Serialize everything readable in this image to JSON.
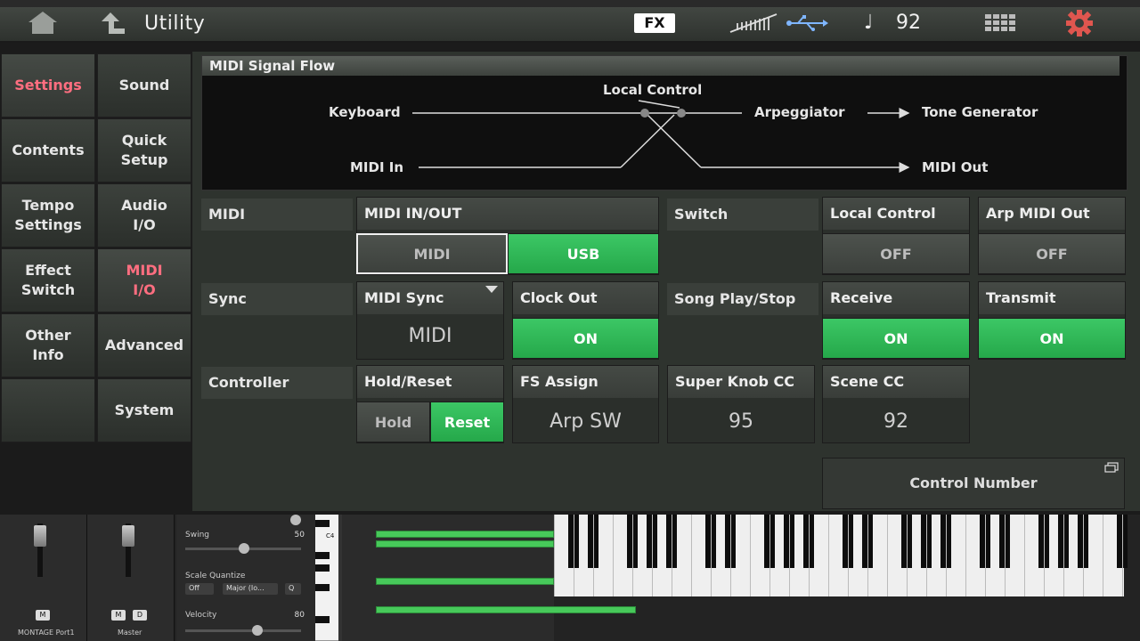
{
  "header": {
    "title": "Utility",
    "fx_label": "FX",
    "note_symbol": "♩",
    "tempo": "92"
  },
  "nav": {
    "left": [
      {
        "label": "Settings",
        "active": true
      },
      {
        "label": "Contents",
        "active": false
      },
      {
        "label": "Tempo\nSettings",
        "active": false
      },
      {
        "label": "Effect\nSwitch",
        "active": false
      },
      {
        "label": "Other\nInfo",
        "active": false
      }
    ],
    "right": [
      {
        "label": "Sound",
        "active": false
      },
      {
        "label": "Quick\nSetup",
        "active": false
      },
      {
        "label": "Audio\nI/O",
        "active": false
      },
      {
        "label": "MIDI\nI/O",
        "active": true
      },
      {
        "label": "Advanced",
        "active": false
      },
      {
        "label": "System",
        "active": false
      }
    ]
  },
  "flow": {
    "title": "MIDI Signal Flow",
    "keyboard": "Keyboard",
    "local_control": "Local Control",
    "arpeggiator": "Arpeggiator",
    "tone_generator": "Tone Generator",
    "midi_in": "MIDI In",
    "midi_out": "MIDI Out"
  },
  "rows": {
    "midi": "MIDI",
    "sync": "Sync",
    "controller": "Controller"
  },
  "midi_inout": {
    "label": "MIDI IN/OUT",
    "option_midi": "MIDI",
    "option_usb": "USB",
    "selected": "USB"
  },
  "switch": {
    "label": "Switch"
  },
  "local_control": {
    "label": "Local Control",
    "value": "OFF"
  },
  "arp_midi_out": {
    "label": "Arp MIDI Out",
    "value": "OFF"
  },
  "midi_sync": {
    "label": "MIDI Sync",
    "value": "MIDI"
  },
  "clock_out": {
    "label": "Clock Out",
    "value": "ON"
  },
  "song_play_stop": {
    "label": "Song Play/Stop"
  },
  "receive": {
    "label": "Receive",
    "value": "ON"
  },
  "transmit": {
    "label": "Transmit",
    "value": "ON"
  },
  "hold_reset": {
    "label": "Hold/Reset",
    "option_hold": "Hold",
    "option_reset": "Reset",
    "selected": "Reset"
  },
  "fs_assign": {
    "label": "FS Assign",
    "value": "Arp SW"
  },
  "super_knob_cc": {
    "label": "Super Knob CC",
    "value": "95"
  },
  "scene_cc": {
    "label": "Scene CC",
    "value": "92"
  },
  "control_number": {
    "label": "Control Number"
  },
  "logic": {
    "strip1": {
      "name": "MONTAGE Port1",
      "m": "M"
    },
    "strip2": {
      "name": "Master",
      "m": "M",
      "d": "D"
    },
    "swing": {
      "label": "Swing",
      "value": "50"
    },
    "scale_quantize": {
      "label": "Scale Quantize",
      "off": "Off",
      "scale": "Major (Io...",
      "q": "Q"
    },
    "velocity": {
      "label": "Velocity",
      "value": "80"
    },
    "c4": "C4"
  },
  "colors": {
    "accent_on": "#2fb955",
    "nav_active": "#ff6e80"
  }
}
